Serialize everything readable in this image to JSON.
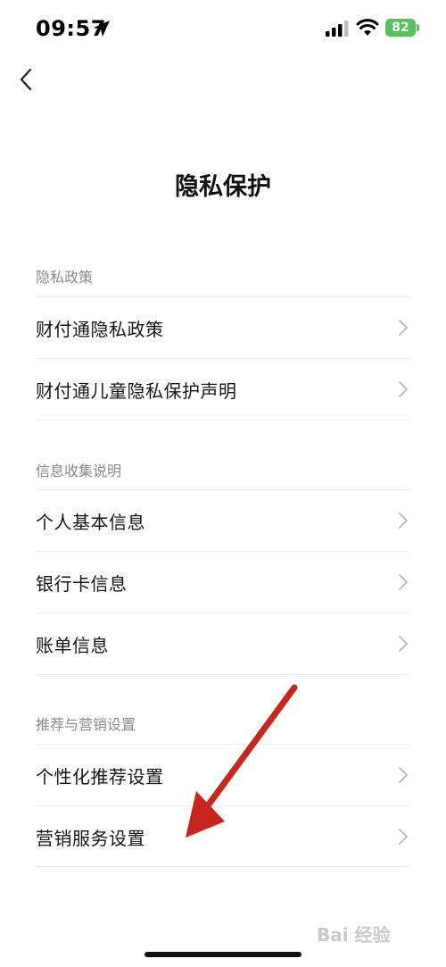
{
  "status_bar": {
    "time": "09:57",
    "battery": "82",
    "icons": [
      "location-icon",
      "signal-icon",
      "wifi-icon",
      "battery-icon"
    ]
  },
  "nav": {
    "back_icon": "chevron-left-icon",
    "title": "隐私保护"
  },
  "sections": [
    {
      "header": "隐私政策",
      "items": [
        {
          "label": "财付通隐私政策"
        },
        {
          "label": "财付通儿童隐私保护声明"
        }
      ]
    },
    {
      "header": "信息收集说明",
      "items": [
        {
          "label": "个人基本信息"
        },
        {
          "label": "银行卡信息"
        },
        {
          "label": "账单信息"
        }
      ]
    },
    {
      "header": "推荐与营销设置",
      "items": [
        {
          "label": "个性化推荐设置"
        },
        {
          "label": "营销服务设置"
        }
      ]
    }
  ],
  "annotation": {
    "type": "red-arrow",
    "color": "#c8261c",
    "points_to": "营销服务设置"
  },
  "watermark": {
    "text": "Bai 经验"
  },
  "colors": {
    "battery": "#57c25d",
    "section_header": "#8a8a8a",
    "divider": "#ececec"
  }
}
